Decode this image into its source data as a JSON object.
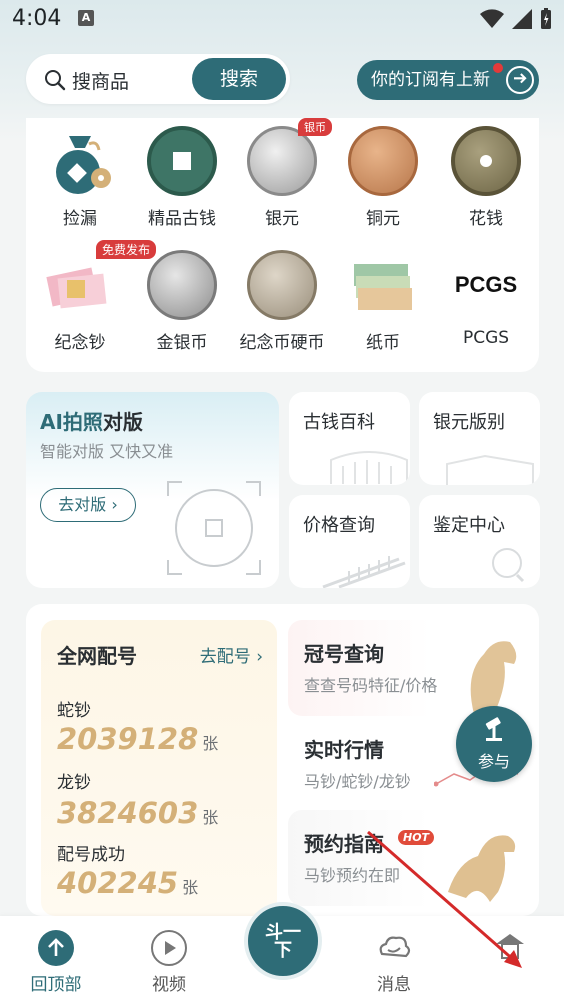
{
  "status": {
    "time": "4:04",
    "indicator": "A"
  },
  "search": {
    "placeholder": "搜商品",
    "button": "搜索"
  },
  "subscribe": {
    "label": "你的订阅有上新"
  },
  "categories": [
    {
      "label": "捡漏",
      "icon": "money-bag-icon"
    },
    {
      "label": "精品古钱",
      "icon": "ancient-coin-icon"
    },
    {
      "label": "银元",
      "icon": "silver-dollar-icon",
      "tag": "银币"
    },
    {
      "label": "铜元",
      "icon": "copper-coin-icon"
    },
    {
      "label": "花钱",
      "icon": "flower-coin-icon"
    },
    {
      "label": "纪念钞",
      "icon": "commemorative-note-icon",
      "tag": "免费发布"
    },
    {
      "label": "金银币",
      "icon": "gold-silver-coin-icon"
    },
    {
      "label": "纪念币硬币",
      "icon": "commemorative-coin-icon"
    },
    {
      "label": "纸币",
      "icon": "banknote-icon"
    },
    {
      "label": "PCGS",
      "icon": "pcgs-logo-icon"
    }
  ],
  "ai": {
    "title_accent": "AI拍照",
    "title_rest": "对版",
    "subtitle": "智能对版 又快又准",
    "button": "去对版"
  },
  "tools": [
    {
      "label": "古钱百科"
    },
    {
      "label": "银元版别"
    },
    {
      "label": "价格查询"
    },
    {
      "label": "鉴定中心"
    }
  ],
  "match": {
    "title": "全网配号",
    "link": "去配号",
    "stats": [
      {
        "label": "蛇钞",
        "value": "2039128",
        "unit": "张"
      },
      {
        "label": "龙钞",
        "value": "3824603",
        "unit": "张"
      },
      {
        "label": "配号成功",
        "value": "402245",
        "unit": "张"
      }
    ]
  },
  "services": [
    {
      "title": "冠号查询",
      "subtitle": "查查号码特征/价格"
    },
    {
      "title": "实时行情",
      "subtitle": "马钞/蛇钞/龙钞"
    },
    {
      "title": "预约指南",
      "subtitle": "马钞预约在即",
      "badge": "HOT"
    }
  ],
  "float_button": {
    "label": "参与"
  },
  "tabbar": {
    "items": [
      {
        "label": "回顶部"
      },
      {
        "label": "视频"
      },
      {
        "label": "消息"
      },
      {
        "label": ""
      }
    ],
    "center": {
      "label": "斗一下"
    }
  },
  "colors": {
    "primary": "#2e6c77",
    "gold": "#d4b078",
    "red": "#d83c3c"
  }
}
